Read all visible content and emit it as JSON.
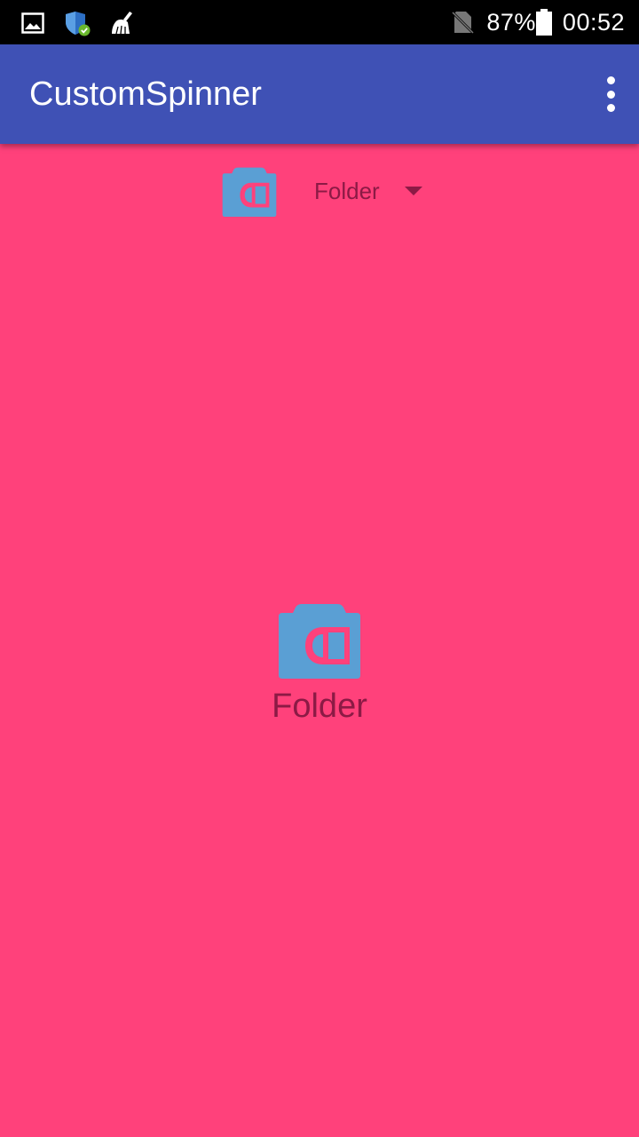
{
  "status_bar": {
    "battery": "87%",
    "time": "00:52",
    "icons": [
      "image-icon",
      "shield-check-icon",
      "broom-icon",
      "no-sim-icon",
      "battery-icon"
    ]
  },
  "app_bar": {
    "title": "CustomSpinner",
    "menu_icon": "overflow-menu-icon"
  },
  "spinner": {
    "selected_label": "Folder",
    "icon": "camera-icon",
    "arrow_icon": "dropdown-arrow-icon"
  },
  "selection": {
    "label": "Folder",
    "icon": "camera-icon"
  },
  "colors": {
    "status_bar": "#000000",
    "app_bar": "#3f51b5",
    "background": "#ff417b",
    "icon_blue": "#5a9fd4",
    "text": "#8c1a45"
  }
}
